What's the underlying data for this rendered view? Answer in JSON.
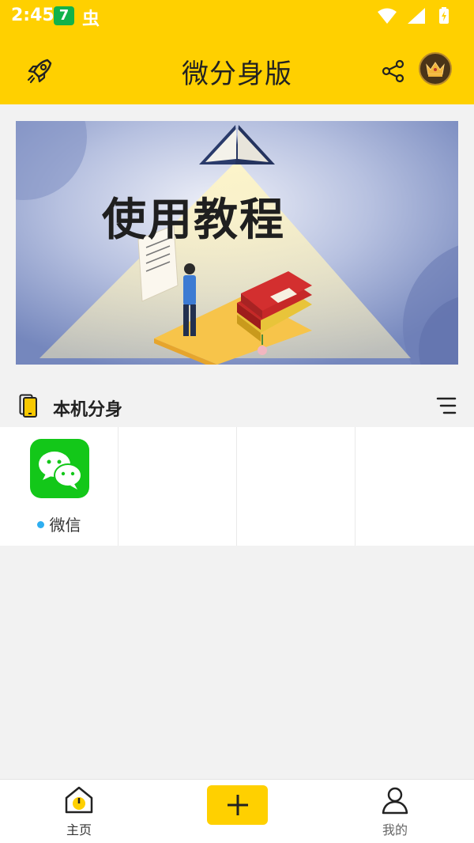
{
  "status": {
    "time": "2:45",
    "badge": "7",
    "bug_glyph": "虫"
  },
  "header": {
    "title": "微分身版"
  },
  "banner": {
    "title": "使用教程"
  },
  "section": {
    "label": "本机分身"
  },
  "apps": [
    {
      "name": "微信",
      "icon": "wechat-icon"
    }
  ],
  "nav": {
    "home_label": "主页",
    "mine_label": "我的"
  },
  "colors": {
    "accent": "#ffd000",
    "wechat": "#13c719",
    "dot": "#2eaef0"
  }
}
